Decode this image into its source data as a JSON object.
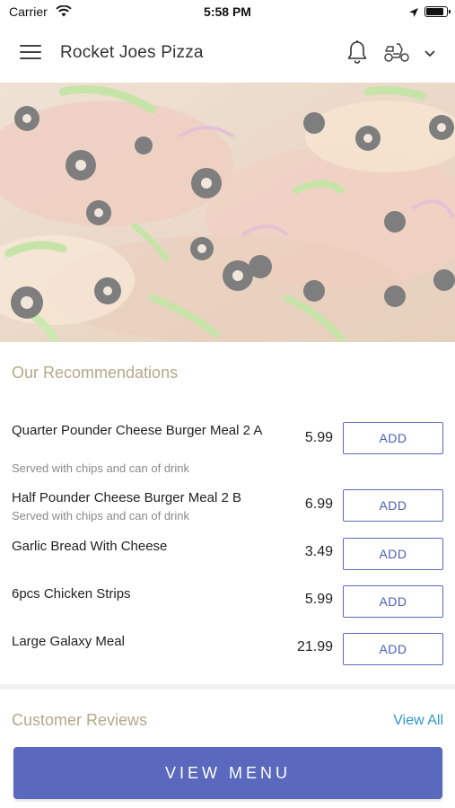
{
  "status_bar": {
    "carrier": "Carrier",
    "time": "5:58 PM"
  },
  "header": {
    "title": "Rocket Joes Pizza",
    "icons": [
      "menu-icon",
      "bell-icon",
      "scooter-icon",
      "chevron-down-icon"
    ]
  },
  "hero": {
    "image": "pizza-photo"
  },
  "recommendations": {
    "title": "Our Recommendations",
    "items": [
      {
        "name": "Quarter Pounder Cheese Burger Meal 2 A",
        "desc": "Served with chips and can of drink",
        "price": "5.99",
        "button": "ADD"
      },
      {
        "name": "Half Pounder Cheese Burger Meal 2 B",
        "desc": "Served with chips and can of drink",
        "price": "6.99",
        "button": "ADD"
      },
      {
        "name": "Garlic Bread With Cheese",
        "desc": "",
        "price": "3.49",
        "button": "ADD"
      },
      {
        "name": "6pcs Chicken Strips",
        "desc": "",
        "price": "5.99",
        "button": "ADD"
      },
      {
        "name": "Large Galaxy Meal",
        "desc": "",
        "price": "21.99",
        "button": "ADD"
      }
    ]
  },
  "reviews": {
    "title": "Customer Reviews",
    "view_all": "View All"
  },
  "footer": {
    "view_menu": "VIEW MENU"
  },
  "colors": {
    "accent": "#5a68bd",
    "section_title": "#b5a88a",
    "link": "#2b98c8"
  }
}
